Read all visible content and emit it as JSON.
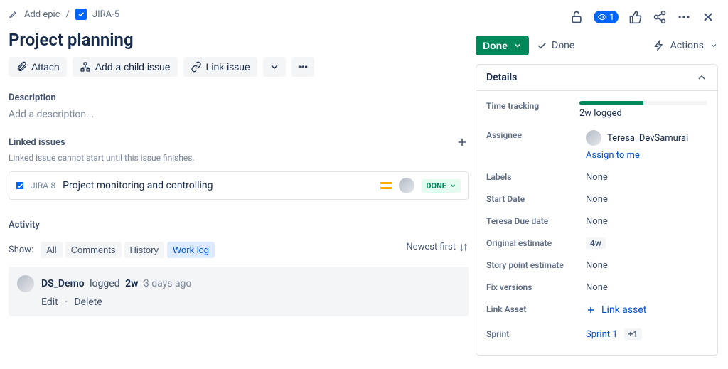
{
  "breadcrumb": {
    "add_epic": "Add epic",
    "issue_key": "JIRA-5"
  },
  "title": "Project planning",
  "toolbar": {
    "attach": "Attach",
    "add_child": "Add a child issue",
    "link_issue": "Link issue"
  },
  "description": {
    "label": "Description",
    "placeholder": "Add a description..."
  },
  "linked": {
    "label": "Linked issues",
    "note": "Linked issue cannot start until this issue finishes.",
    "items": [
      {
        "key": "JIRA-8",
        "summary": "Project monitoring and controlling",
        "status": "DONE"
      }
    ]
  },
  "activity": {
    "label": "Activity",
    "show_label": "Show:",
    "tabs": [
      "All",
      "Comments",
      "History",
      "Work log"
    ],
    "active_tab": 3,
    "sort_label": "Newest first",
    "worklog": [
      {
        "author": "DS_Demo",
        "verb": "logged",
        "duration": "2w",
        "when": "3 days ago",
        "edit": "Edit",
        "delete": "Delete"
      }
    ]
  },
  "right_top": {
    "watch_count": "1"
  },
  "status": {
    "button": "Done",
    "done_label": "Done",
    "actions_label": "Actions"
  },
  "details": {
    "header": "Details",
    "time_tracking_label": "Time tracking",
    "time_tracking_value": "2w logged",
    "time_tracking_pct": 50,
    "assignee_label": "Assignee",
    "assignee_value": "Teresa_DevSamurai",
    "assign_to_me": "Assign to me",
    "labels_label": "Labels",
    "labels_value": "None",
    "start_date_label": "Start Date",
    "start_date_value": "None",
    "due_label": "Teresa Due date",
    "due_value": "None",
    "orig_est_label": "Original estimate",
    "orig_est_value": "4w",
    "story_point_label": "Story point estimate",
    "story_point_value": "None",
    "fix_versions_label": "Fix versions",
    "fix_versions_value": "None",
    "link_asset_label": "Link Asset",
    "link_asset_action": "Link asset",
    "sprint_label": "Sprint",
    "sprint_value": "Sprint 1",
    "sprint_extra": "+1"
  }
}
